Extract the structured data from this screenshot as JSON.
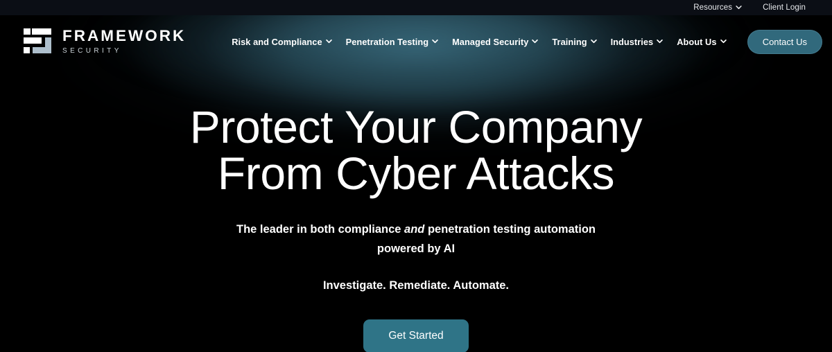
{
  "utility_bar": {
    "items": [
      {
        "label": "Resources",
        "icon": "chevron-down-icon",
        "has_chevron": true
      },
      {
        "label": "Client Login",
        "icon": "",
        "has_chevron": false
      }
    ]
  },
  "brand": {
    "name": "FRAMEWORK",
    "sub": "SECURITY",
    "logo_icon": "framework-security-logo-icon"
  },
  "nav": {
    "items": [
      {
        "label": "Risk and Compliance",
        "has_chevron": true
      },
      {
        "label": "Penetration Testing",
        "has_chevron": true
      },
      {
        "label": "Managed Security",
        "has_chevron": true
      },
      {
        "label": "Training",
        "has_chevron": true
      },
      {
        "label": "Industries",
        "has_chevron": true
      },
      {
        "label": "About Us",
        "has_chevron": true
      }
    ],
    "contact_label": "Contact Us"
  },
  "hero": {
    "headline_line1": "Protect Your Company",
    "headline_line2": "From Cyber Attacks",
    "subtitle_part1": "The leader in both compliance ",
    "subtitle_emphasis": "and",
    "subtitle_part2": " penetration testing automation powered by AI",
    "tagline": "Investigate. Remediate. Automate.",
    "cta_label": "Get Started"
  },
  "colors": {
    "page_background": "#000000",
    "utility_bar_background": "#0b0e15",
    "glow_teal": "#3c6e80",
    "contact_button": "#31697c",
    "cta_button": "#2f7487",
    "text_primary": "#ffffff",
    "text_secondary": "#cdd5da"
  }
}
